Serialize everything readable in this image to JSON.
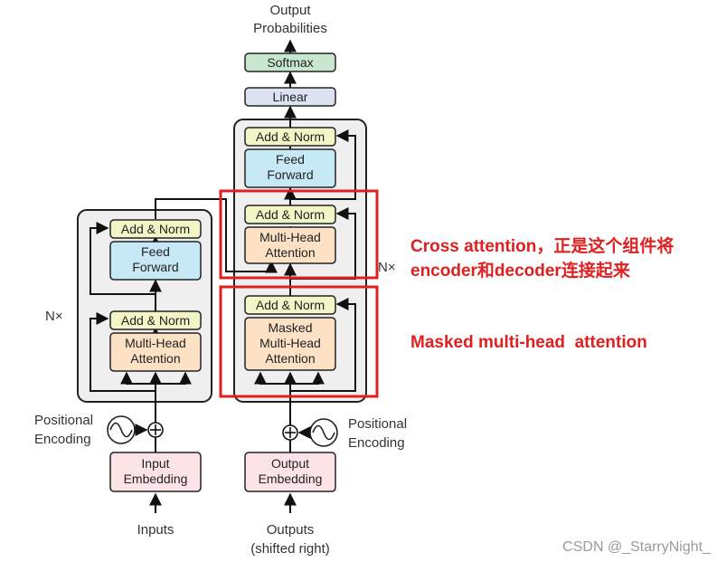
{
  "colors": {
    "add_norm": "#f2f5c6",
    "ffn": "#c7e8f5",
    "attention": "#fce1c4",
    "embedding": "#fce3e6",
    "softmax": "#c7e8cf",
    "linear": "#dde1f0",
    "stack_bg": "#efefef",
    "highlight": "#e02020",
    "annotation": "#e02020"
  },
  "top": {
    "output_label_1": "Output",
    "output_label_2": "Probabilities",
    "softmax": "Softmax",
    "linear": "Linear"
  },
  "encoder": {
    "add_norm": "Add & Norm",
    "feed_forward_1": "Feed",
    "feed_forward_2": "Forward",
    "attention_1": "Multi-Head",
    "attention_2": "Attention",
    "nx": "N×",
    "positional_1": "Positional",
    "positional_2": "Encoding",
    "embedding_1": "Input",
    "embedding_2": "Embedding",
    "input_label": "Inputs"
  },
  "decoder": {
    "add_norm": "Add & Norm",
    "feed_forward_1": "Feed",
    "feed_forward_2": "Forward",
    "cross_attention_1": "Multi-Head",
    "cross_attention_2": "Attention",
    "masked_1": "Masked",
    "masked_2": "Multi-Head",
    "masked_3": "Attention",
    "nx": "N×",
    "positional_1": "Positional",
    "positional_2": "Encoding",
    "embedding_1": "Output",
    "embedding_2": "Embedding",
    "output_label_1": "Outputs",
    "output_label_2": "(shifted right)"
  },
  "annotations": {
    "cross_1": "Cross attention，正是这个组件将",
    "cross_2": "encoder和decoder连接起来",
    "masked": "Masked multi-head  attention"
  },
  "watermark": "CSDN @_StarryNight_"
}
